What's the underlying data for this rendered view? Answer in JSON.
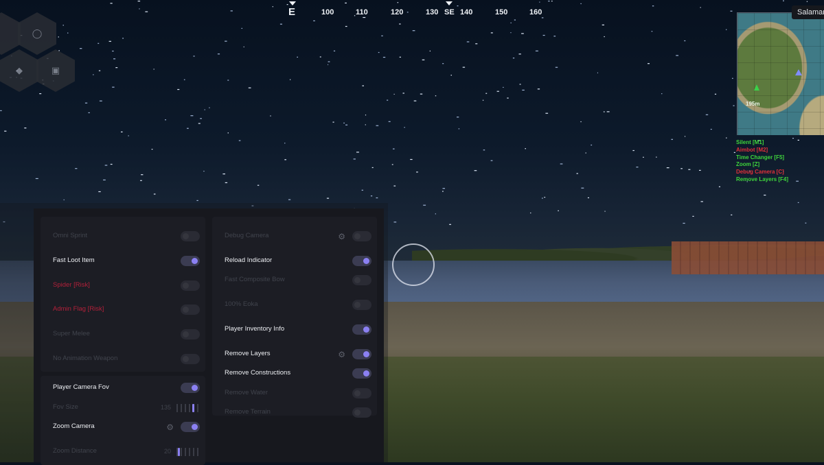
{
  "compass": {
    "cardinal": "E",
    "headings": [
      "100",
      "110",
      "120",
      "130",
      "SE",
      "140",
      "150",
      "160"
    ]
  },
  "minimap": {
    "location": "Salamanca",
    "distance": "195m",
    "player_marker": "green-arrow-icon",
    "poi_marker": "blue-triangle-icon"
  },
  "keybinds": [
    {
      "label": "Silent [M1]",
      "color": "#3fd63c"
    },
    {
      "label": "Aimbot [M2]",
      "color": "#e0303a"
    },
    {
      "label": "Time Changer [F5]",
      "color": "#3fd63c"
    },
    {
      "label": "Zoom [Z]",
      "color": "#3fd63c"
    },
    {
      "label": "Debug Camera [C]",
      "color": "#e0303a"
    },
    {
      "label": "Remove Layers [F4]",
      "color": "#3fd63c"
    }
  ],
  "hex_icons": [
    "unknown-icon",
    "shield-icon",
    "tag-icon",
    "folder-icon"
  ],
  "panel": {
    "left_top": [
      {
        "label": "Omni Sprint",
        "state": "disabled"
      },
      {
        "label": "Fast Loot Item",
        "state": "on"
      },
      {
        "label": "Spider [Risk]",
        "state": "risk"
      },
      {
        "label": "Admin Flag [Risk]",
        "state": "risk"
      },
      {
        "label": "Super Melee",
        "state": "disabled"
      },
      {
        "label": "No Animation Weapon",
        "state": "disabled"
      }
    ],
    "left_bottom": {
      "camera_fov_label": "Player Camera Fov",
      "fov_size_label": "Fov Size",
      "fov_size_value": "135",
      "fov_size_fraction": 0.75,
      "zoom_camera_label": "Zoom Camera",
      "zoom_distance_label": "Zoom Distance",
      "zoom_distance_value": "20",
      "zoom_distance_fraction": 0.05
    },
    "right": [
      {
        "label": "Debug Camera",
        "state": "disabled",
        "gear": true
      },
      {
        "label": "Reload Indicator",
        "state": "on",
        "gear": false
      },
      {
        "label": "Fast Composite Bow",
        "state": "disabled",
        "gear": false
      },
      {
        "label": "100% Eoka",
        "state": "disabled",
        "gear": false
      },
      {
        "label": "Player Inventory Info",
        "state": "on",
        "gear": false
      },
      {
        "label": "Remove Layers",
        "state": "on",
        "gear": true
      },
      {
        "label": "Remove Constructions",
        "state": "on",
        "gear": false
      },
      {
        "label": "Remove Water",
        "state": "disabled",
        "gear": false
      },
      {
        "label": "Remove Terrain",
        "state": "disabled",
        "gear": false
      }
    ]
  },
  "colors": {
    "accent": "#8b80f2",
    "risk": "#b3203a",
    "bind_on": "#3fd63c",
    "bind_off": "#e0303a"
  }
}
